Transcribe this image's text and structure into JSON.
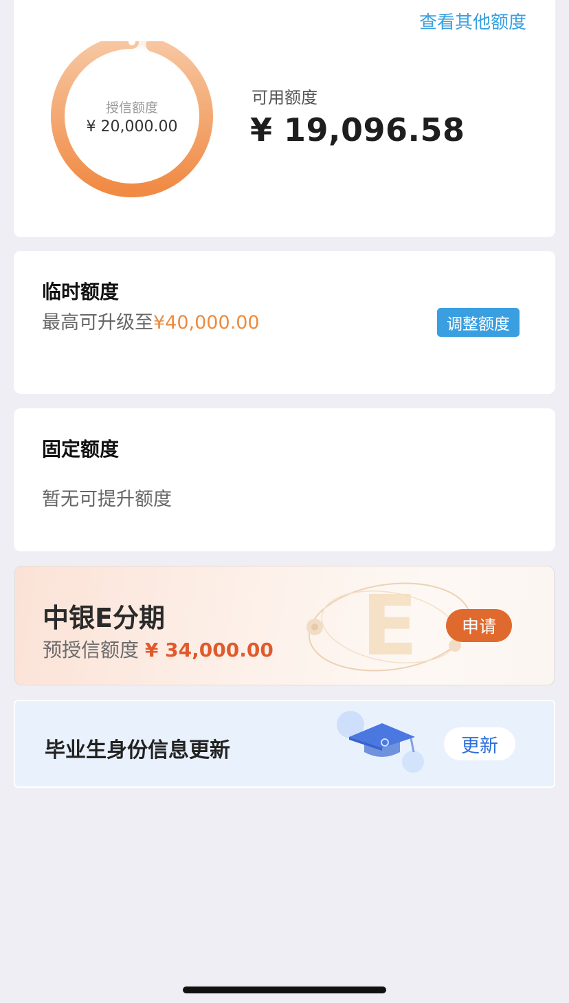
{
  "credit_card": {
    "view_other_label": "查看其他额度",
    "ring_label": "授信额度",
    "ring_value": "¥ 20,000.00",
    "available_label": "可用额度",
    "available_value": "¥ 19,096.58",
    "used_fraction": 0.0452,
    "ring_color_start": "#f08a44",
    "ring_color_end": "#f7c7a2"
  },
  "temp_limit": {
    "title": "临时额度",
    "subtitle_prefix": "最高可升级至",
    "subtitle_amount": "¥40,000.00",
    "button_label": "调整额度"
  },
  "fixed_limit": {
    "title": "固定额度",
    "subtitle": "暂无可提升额度"
  },
  "e_installment": {
    "title": "中银E分期",
    "subtitle_prefix": "预授信额度",
    "amount": "¥ 34,000.00",
    "button_label": "申请",
    "deco_letter": "E",
    "deco_icon": "e-letter-orbit-icon"
  },
  "graduate_update": {
    "title": "毕业生身份信息更新",
    "button_label": "更新",
    "deco_icon": "graduation-cap-icon"
  },
  "colors": {
    "accent_blue": "#3a9fe0",
    "accent_orange": "#ee8a3c",
    "apply_orange": "#e06a2d",
    "update_blue": "#2d6fdb"
  }
}
